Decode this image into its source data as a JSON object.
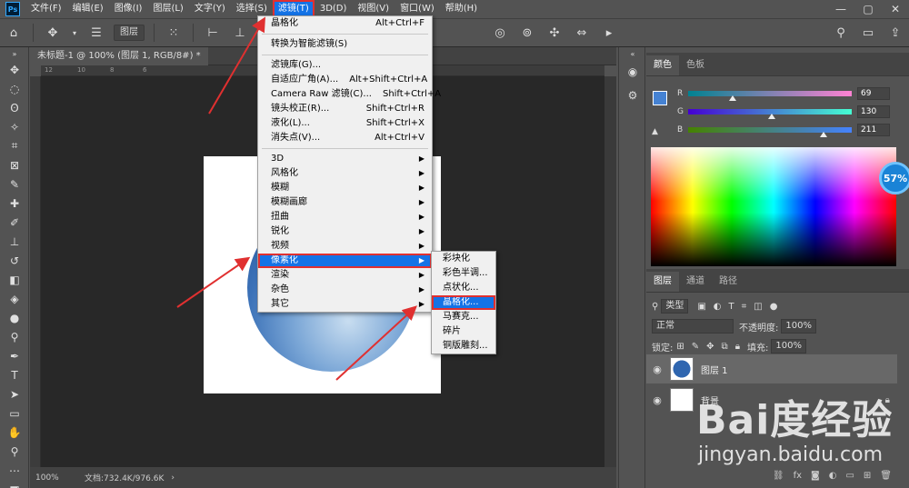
{
  "app": {
    "logo": "Ps"
  },
  "menubar": {
    "items": [
      "文件(F)",
      "编辑(E)",
      "图像(I)",
      "图层(L)",
      "文字(Y)",
      "选择(S)",
      "滤镜(T)",
      "3D(D)",
      "视图(V)",
      "窗口(W)",
      "帮助(H)"
    ],
    "active_index": 6,
    "window_controls": [
      "—",
      "▢",
      "✕"
    ]
  },
  "options_bar": {
    "layer_select": "图层"
  },
  "document": {
    "tab_title": "未标题-1 @ 100% (图层 1, RGB/8#) *",
    "zoom": "100%",
    "doc_info": "文档:732.4K/976.6K",
    "ruler_ticks": [
      "12",
      "10",
      "8",
      "6"
    ]
  },
  "filter_menu": {
    "items": [
      {
        "label": "晶格化",
        "shortcut": "Alt+Ctrl+F"
      },
      {
        "sep": true
      },
      {
        "label": "转换为智能滤镜(S)",
        "shortcut": ""
      },
      {
        "sep": true
      },
      {
        "label": "滤镜库(G)...",
        "shortcut": ""
      },
      {
        "label": "自适应广角(A)...",
        "shortcut": "Alt+Shift+Ctrl+A"
      },
      {
        "label": "Camera Raw 滤镜(C)...",
        "shortcut": "Shift+Ctrl+A"
      },
      {
        "label": "镜头校正(R)...",
        "shortcut": "Shift+Ctrl+R"
      },
      {
        "label": "液化(L)...",
        "shortcut": "Shift+Ctrl+X"
      },
      {
        "label": "消失点(V)...",
        "shortcut": "Alt+Ctrl+V"
      },
      {
        "sep": true
      },
      {
        "label": "3D",
        "submenu": true
      },
      {
        "label": "风格化",
        "submenu": true
      },
      {
        "label": "模糊",
        "submenu": true
      },
      {
        "label": "模糊画廊",
        "submenu": true
      },
      {
        "label": "扭曲",
        "submenu": true
      },
      {
        "label": "锐化",
        "submenu": true
      },
      {
        "label": "视频",
        "submenu": true
      },
      {
        "label": "像素化",
        "submenu": true,
        "highlight": true
      },
      {
        "label": "渲染",
        "submenu": true
      },
      {
        "label": "杂色",
        "submenu": true
      },
      {
        "label": "其它",
        "submenu": true
      }
    ]
  },
  "pixelate_submenu": {
    "items": [
      {
        "label": "彩块化"
      },
      {
        "label": "彩色半调..."
      },
      {
        "label": "点状化..."
      },
      {
        "label": "晶格化...",
        "highlight": true
      },
      {
        "label": "马赛克..."
      },
      {
        "label": "碎片"
      },
      {
        "label": "铜版雕刻..."
      }
    ]
  },
  "color_panel": {
    "tabs": [
      "颜色",
      "色板"
    ],
    "channels": [
      {
        "label": "R",
        "value": "69",
        "fraction": 0.27,
        "gradient": "linear-gradient(to right, #008291, #ff82d3)"
      },
      {
        "label": "G",
        "value": "130",
        "fraction": 0.51,
        "gradient": "linear-gradient(to right, #4500d3, #45ffd3)"
      },
      {
        "label": "B",
        "value": "211",
        "fraction": 0.83,
        "gradient": "linear-gradient(to right, #458200, #4582ff)"
      }
    ],
    "badge": "57%"
  },
  "layers_panel": {
    "tabs": [
      "图层",
      "通道",
      "路径"
    ],
    "filter_kind": "类型",
    "blend_mode": "正常",
    "opacity_label": "不透明度:",
    "opacity_value": "100%",
    "lock_label": "锁定:",
    "fill_label": "填充:",
    "fill_value": "100%",
    "layers": [
      {
        "name": "图层 1",
        "selected": true,
        "locked": false
      },
      {
        "name": "背景",
        "selected": false,
        "locked": true
      }
    ],
    "footer_icons": [
      "link-icon",
      "fx-icon",
      "mask-icon",
      "adjustment-icon",
      "group-icon",
      "new-layer-icon",
      "trash-icon"
    ]
  },
  "watermark": {
    "logo": "Bai度经验",
    "url": "jingyan.baidu.com"
  },
  "colors": {
    "accent": "#1473e6",
    "annotation_red": "#e03030",
    "fg_swatch": "#4582d3"
  }
}
